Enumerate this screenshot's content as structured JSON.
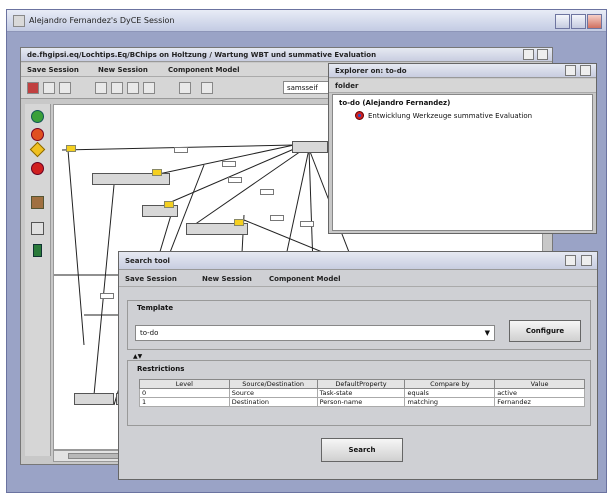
{
  "window": {
    "title": "Alejandro Fernandez's DyCE Session"
  },
  "session": {
    "title": "de.fhgipsi.eq/Lochtips.Eq/BChips on Holtzung / Wartung WBT und summative Evaluation",
    "menu": [
      "Save Session",
      "New Session",
      "Component Model"
    ],
    "zoom_value": "samsseif"
  },
  "explorer": {
    "title": "Explorer on: to-do",
    "menu_label": "folder",
    "root_label": "to-do  (Alejandro Fernandez)",
    "child_label": "Entwicklung Werkzeuge summative Evaluation"
  },
  "search": {
    "title": "Search tool",
    "menu": [
      "Save Session",
      "New Session",
      "Component Model"
    ],
    "template_label": "Template",
    "template_value": "to-do",
    "configure_label": "Configure",
    "restrictions_label": "Restrictions",
    "columns": [
      "Level",
      "Source/Destination",
      "DefaultProperty",
      "Compare by",
      "Value"
    ],
    "rows": [
      [
        "0",
        "Source",
        "Task-state",
        "equals",
        "active"
      ],
      [
        "1",
        "Destination",
        "Person-name",
        "matching",
        "Fernandez"
      ]
    ],
    "search_button": "Search"
  },
  "colors": {
    "outer_bg": "#9aa3c6",
    "title_gradient_top": "#e8ecf6",
    "node_tag": "#f5d020",
    "icon_red": "#d02020"
  }
}
